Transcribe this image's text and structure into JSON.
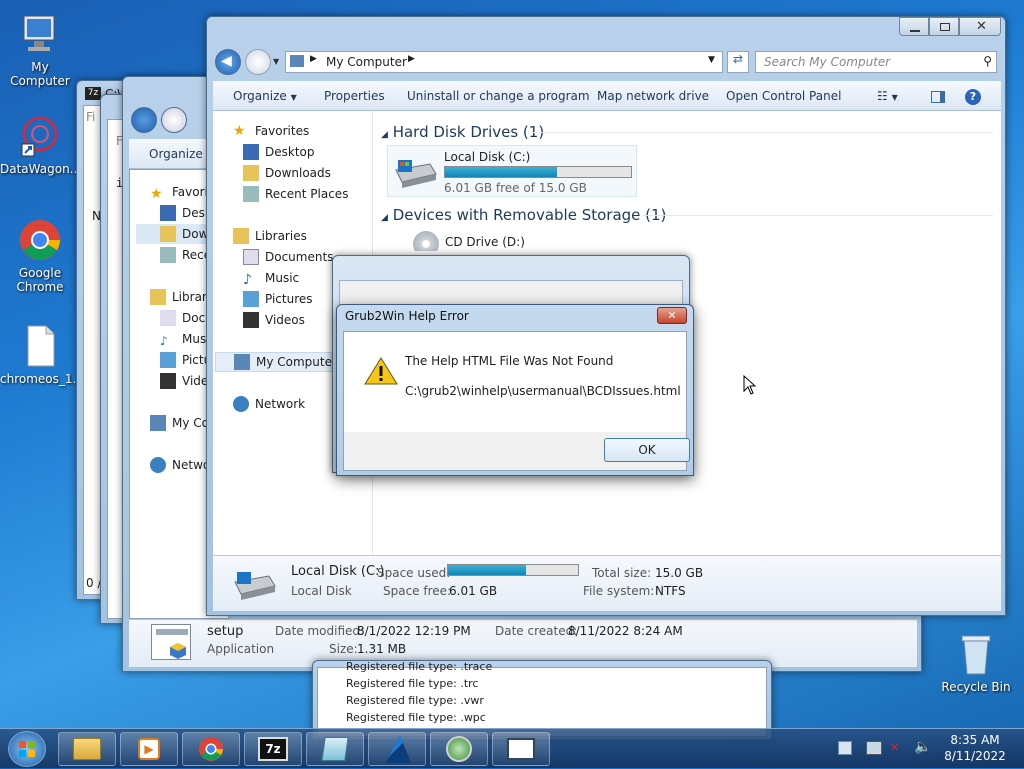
{
  "desktop": {
    "icons": [
      {
        "label": "My Computer"
      },
      {
        "label": "DataWagon..."
      },
      {
        "label": "Google Chrome"
      },
      {
        "label": "chromeos_1..."
      },
      {
        "label": "Recycle Bin"
      }
    ]
  },
  "back_windows": {
    "w1_title": "C:\\",
    "w1_tab": "Fi",
    "w1_row": "N",
    "w1_status": "0 /",
    "w2_tab": "F",
    "w2_cmd": "in",
    "w2_organize": "Organize",
    "w2_nav": [
      "Favorit",
      "Desk",
      "Dow",
      "Rece",
      "Librari",
      "Docu",
      "Musi",
      "Pictu",
      "Vide",
      "My Co",
      "Netwo"
    ]
  },
  "bottom_window": {
    "name": "setup",
    "type": "Application",
    "date_modified_label": "Date modified:",
    "date_modified": "8/1/2022 12:19 PM",
    "size_label": "Size:",
    "size": "1.31 MB",
    "date_created_label": "Date created:",
    "date_created": "8/11/2022 8:24 AM"
  },
  "log_window": {
    "lines": [
      "Registered file type: .trace",
      "Registered file type: .trc",
      "Registered file type: .vwr",
      "Registered file type: .wpc"
    ]
  },
  "explorer": {
    "address_root": "My Computer",
    "search_placeholder": "Search My Computer",
    "toolbar": {
      "organize": "Organize",
      "properties": "Properties",
      "uninstall": "Uninstall or change a program",
      "map_drive": "Map network drive",
      "control_panel": "Open Control Panel"
    },
    "nav": {
      "favorites": "Favorites",
      "desktop": "Desktop",
      "downloads": "Downloads",
      "recent": "Recent Places",
      "libraries": "Libraries",
      "documents": "Documents",
      "music": "Music",
      "pictures": "Pictures",
      "videos": "Videos",
      "my_computer": "My Computer",
      "network": "Network"
    },
    "hdd_section": "Hard Disk Drives (1)",
    "removable_section": "Devices with Removable Storage (1)",
    "drive": {
      "name": "Local Disk (C:)",
      "free_text": "6.01 GB free of 15.0 GB",
      "used_fraction": 0.6
    },
    "cd_drive": "CD Drive (D:)",
    "details": {
      "name": "Local Disk (C:)",
      "type": "Local Disk",
      "space_used_label": "Space used:",
      "space_free_label": "Space free:",
      "space_free": "6.01 GB",
      "total_label": "Total size:",
      "total": "15.0 GB",
      "fs_label": "File system:",
      "fs": "NTFS"
    }
  },
  "dialog": {
    "title": "Grub2Win Help Error",
    "message": "The Help HTML File Was Not Found",
    "path": "C:\\grub2\\winhelp\\usermanual\\BCDIssues.html",
    "ok": "OK"
  },
  "taskbar": {
    "time": "8:35 AM",
    "date": "8/11/2022"
  }
}
